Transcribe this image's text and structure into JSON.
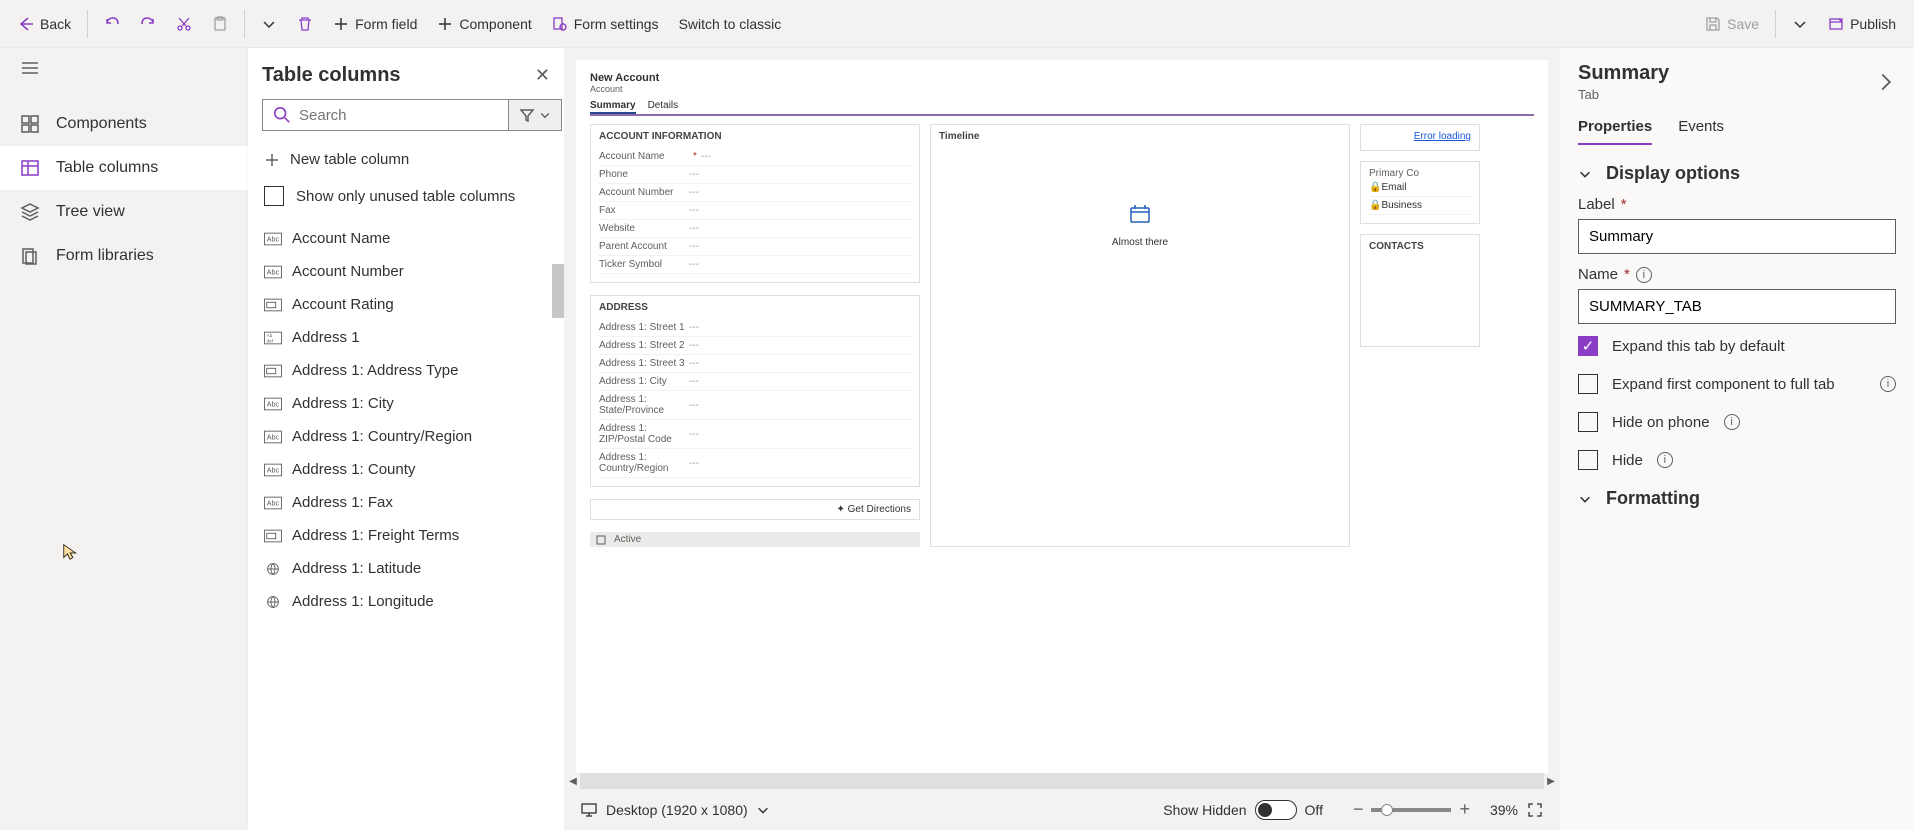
{
  "toolbar": {
    "back": "Back",
    "form_field": "Form field",
    "component": "Component",
    "form_settings": "Form settings",
    "switch_classic": "Switch to classic",
    "save": "Save",
    "publish": "Publish"
  },
  "nav": {
    "components": "Components",
    "table_columns": "Table columns",
    "tree_view": "Tree view",
    "form_libraries": "Form libraries"
  },
  "panel": {
    "title": "Table columns",
    "search_placeholder": "Search",
    "new_table_column": "New table column",
    "show_unused": "Show only unused table columns",
    "columns": [
      "Account Name",
      "Account Number",
      "Account Rating",
      "Address 1",
      "Address 1: Address Type",
      "Address 1: City",
      "Address 1: Country/Region",
      "Address 1: County",
      "Address 1: Fax",
      "Address 1: Freight Terms",
      "Address 1: Latitude",
      "Address 1: Longitude"
    ]
  },
  "form": {
    "title": "New Account",
    "subtitle": "Account",
    "tabs": [
      "Summary",
      "Details"
    ],
    "account_info_title": "ACCOUNT INFORMATION",
    "account_info_fields": [
      "Account Name",
      "Phone",
      "Account Number",
      "Fax",
      "Website",
      "Parent Account",
      "Ticker Symbol"
    ],
    "address_title": "ADDRESS",
    "address_fields": [
      "Address 1: Street 1",
      "Address 1: Street 2",
      "Address 1: Street 3",
      "Address 1: City",
      "Address 1: State/Province",
      "Address 1: ZIP/Postal Code",
      "Address 1: Country/Region"
    ],
    "get_directions": "Get Directions",
    "timeline_title": "Timeline",
    "almost_there": "Almost there",
    "error_loading": "Error loading",
    "contacts_title": "CONTACTS",
    "primary_contact": "Primary Co",
    "email": "Email",
    "business": "Business",
    "status": "Active"
  },
  "footer": {
    "show_hidden": "Show Hidden",
    "toggle_off": "Off",
    "device": "Desktop (1920 x 1080)",
    "zoom": "39%"
  },
  "props": {
    "title": "Summary",
    "subtitle": "Tab",
    "tab_properties": "Properties",
    "tab_events": "Events",
    "display_options": "Display options",
    "label_label": "Label",
    "label_value": "Summary",
    "name_label": "Name",
    "name_value": "SUMMARY_TAB",
    "expand_default": "Expand this tab by default",
    "expand_first": "Expand first component to full tab",
    "hide_phone": "Hide on phone",
    "hide": "Hide",
    "formatting": "Formatting"
  }
}
